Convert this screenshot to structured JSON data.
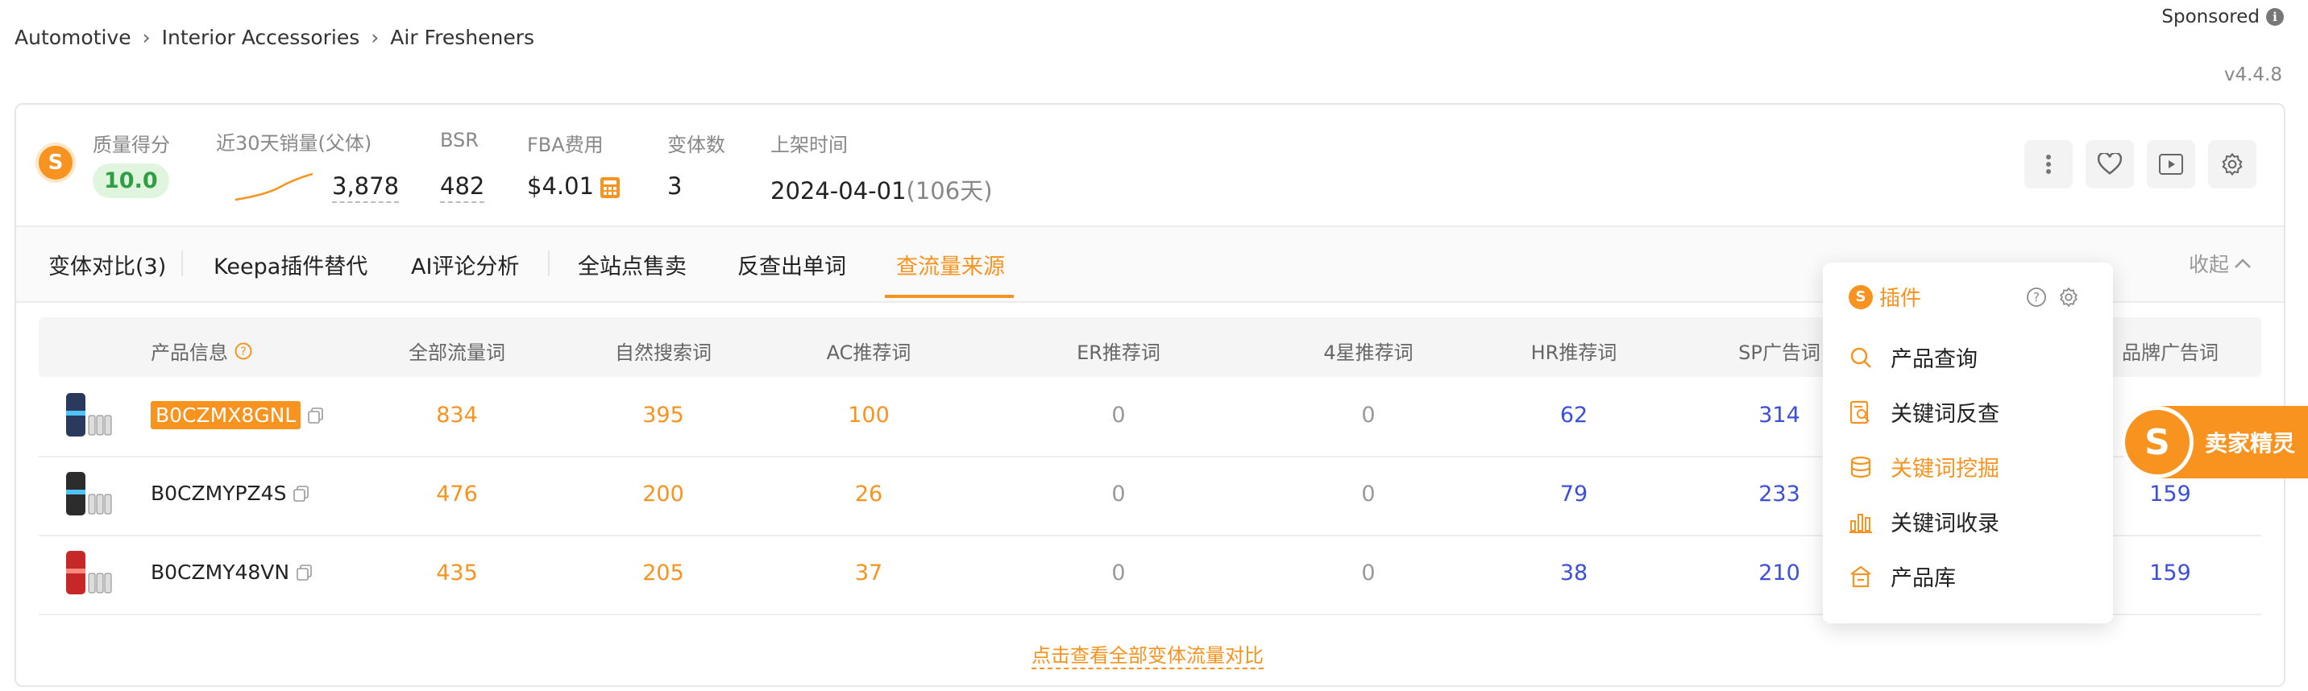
{
  "breadcrumb": [
    "Automotive",
    "Interior Accessories",
    "Air Fresheners"
  ],
  "breadcrumb_sep": "›",
  "sponsored": "Sponsored",
  "version": "v4.4.8",
  "metrics": {
    "quality": {
      "label": "质量得分",
      "value": "10.0"
    },
    "sales": {
      "label": "近30天销量(父体)",
      "value": "3,878"
    },
    "bsr": {
      "label": "BSR",
      "value": "482"
    },
    "fba": {
      "label": "FBA费用",
      "value": "$4.01"
    },
    "variants": {
      "label": "变体数",
      "value": "3"
    },
    "listed": {
      "label": "上架时间",
      "value": "2024-04-01",
      "days": "(106天)"
    }
  },
  "tabs": [
    "变体对比(3)",
    "Keepa插件替代",
    "AI评论分析",
    "全站点售卖",
    "反查出单词",
    "查流量来源"
  ],
  "active_tab": 5,
  "collapse_label": "收起",
  "table": {
    "headers": [
      "产品信息",
      "全部流量词",
      "自然搜索词",
      "AC推荐词",
      "ER推荐词",
      "4星推荐词",
      "HR推荐词",
      "SP广告词",
      "品牌广告词"
    ],
    "rows": [
      {
        "asin": "B0CZMX8GNL",
        "highlight": true,
        "color": "#2a3a5c",
        "cells": [
          "834",
          "395",
          "100",
          "0",
          "0",
          "62",
          "314"
        ],
        "brand": ""
      },
      {
        "asin": "B0CZMYPZ4S",
        "highlight": false,
        "color": "#2c2c2c",
        "cells": [
          "476",
          "200",
          "26",
          "0",
          "0",
          "79",
          "233"
        ],
        "brand": "159"
      },
      {
        "asin": "B0CZMY48VN",
        "highlight": false,
        "color": "#c62828",
        "cells": [
          "435",
          "205",
          "37",
          "0",
          "0",
          "38",
          "210"
        ],
        "brand": "159"
      }
    ]
  },
  "footer_link": "点击查看全部变体流量对比",
  "popup": {
    "title": "插件",
    "items": [
      {
        "label": "产品查询",
        "icon": "search-icon",
        "active": false
      },
      {
        "label": "关键词反查",
        "icon": "document-search-icon",
        "active": false
      },
      {
        "label": "关键词挖掘",
        "icon": "database-icon",
        "active": true
      },
      {
        "label": "关键词收录",
        "icon": "bar-chart-icon",
        "active": false
      },
      {
        "label": "产品库",
        "icon": "store-icon",
        "active": false
      }
    ]
  },
  "side_tab": {
    "label": "卖家精灵"
  },
  "colors": {
    "accent": "#f7931e",
    "blue": "#3b4fd8",
    "green": "#2f9e44"
  }
}
